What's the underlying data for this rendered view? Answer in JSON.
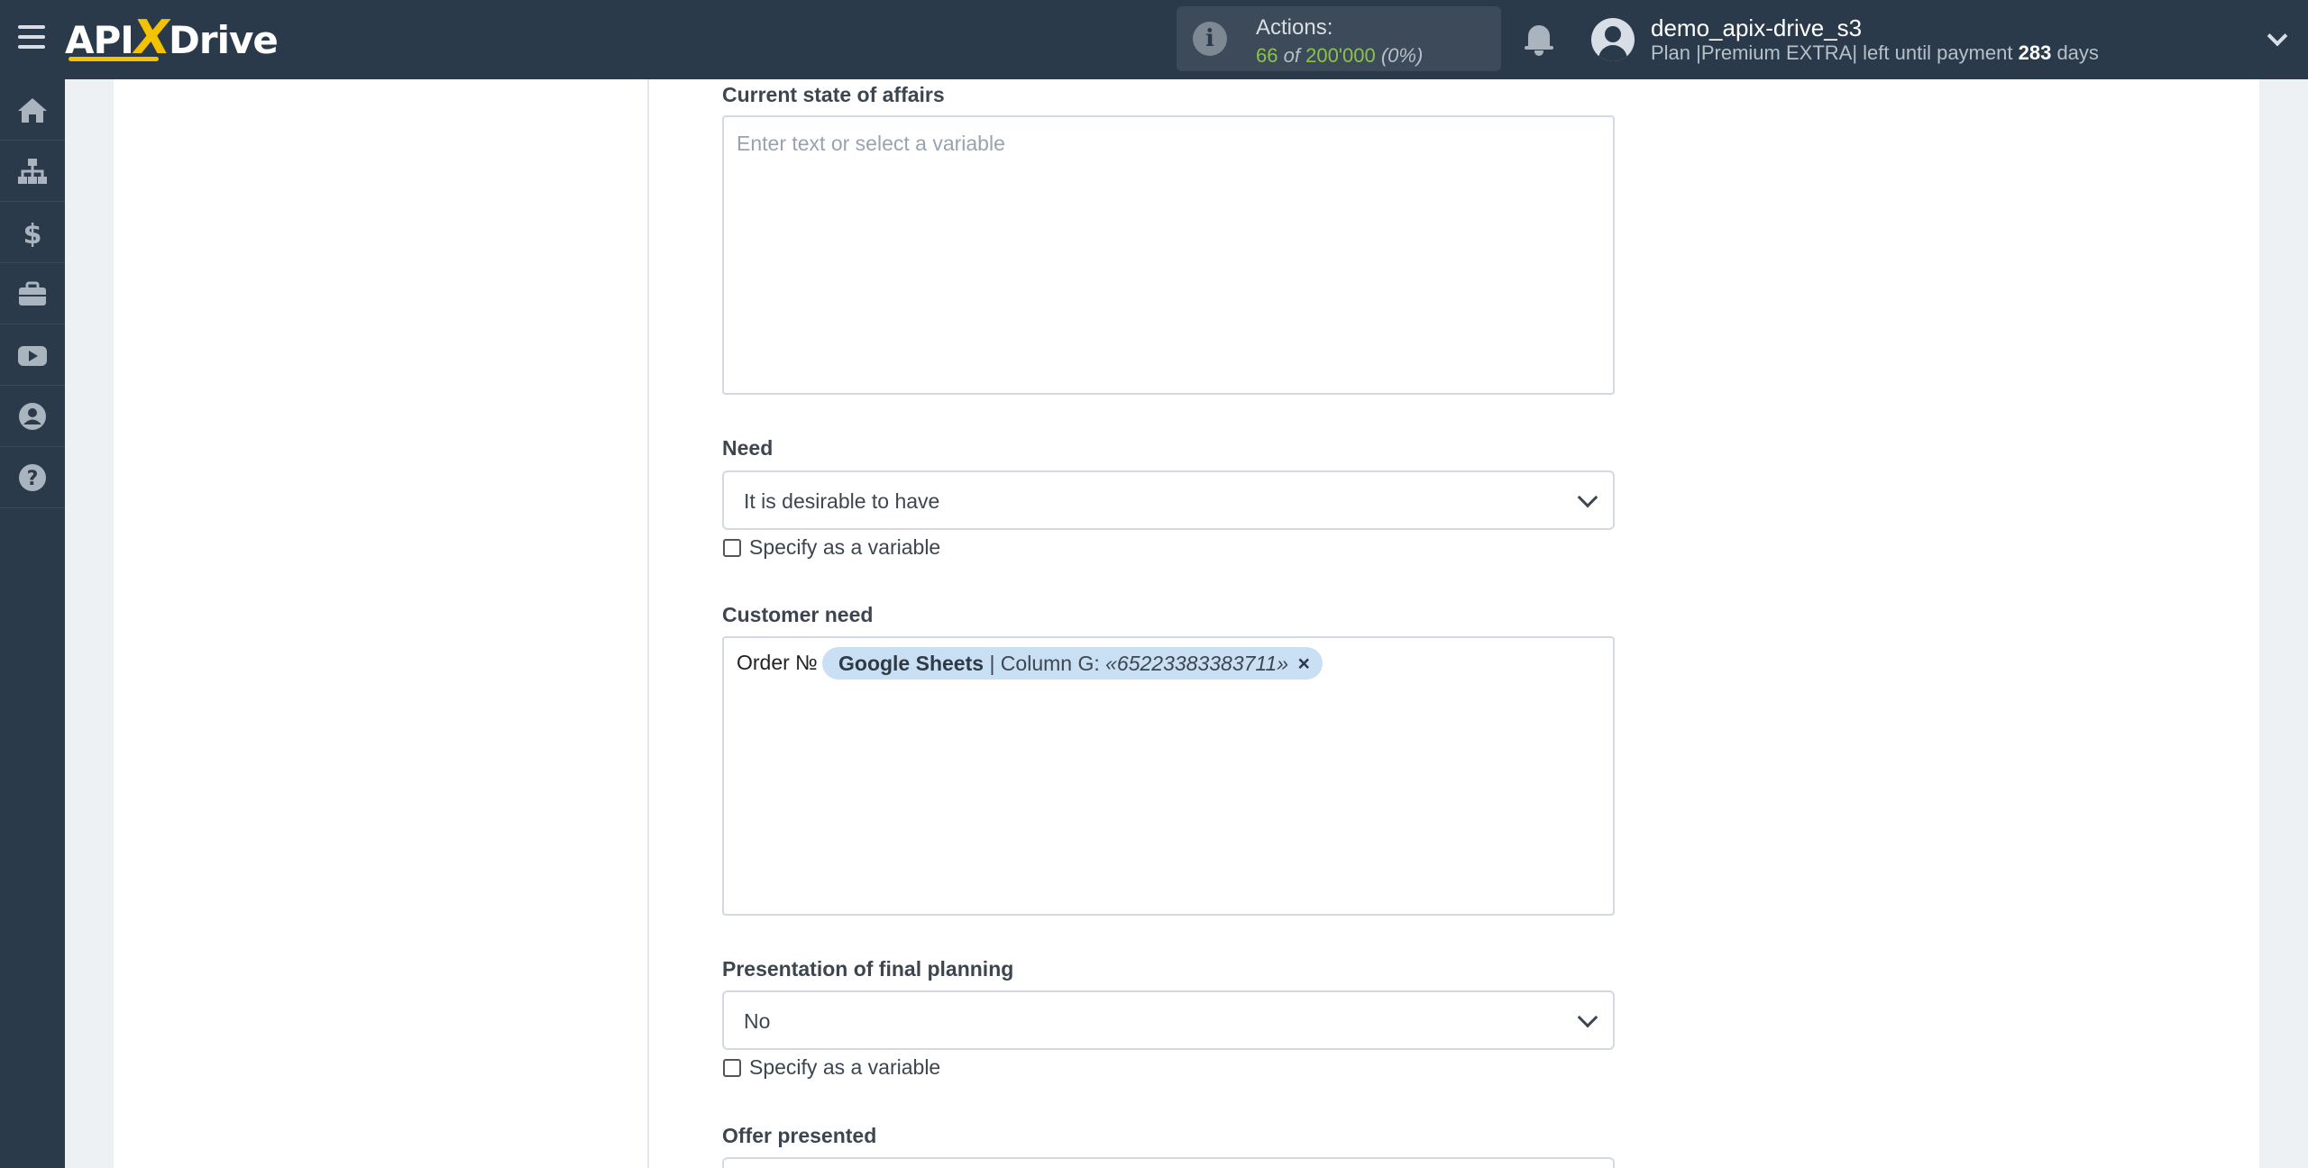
{
  "header": {
    "logo_left": "API",
    "logo_x": "X",
    "logo_right": "Drive",
    "actions_label": "Actions:",
    "actions_used": "66",
    "actions_of": "of",
    "actions_total": "200'000",
    "actions_pct": "(0%)",
    "username": "demo_apix-drive_s3",
    "plan_prefix": "Plan |Premium EXTRA| left until payment",
    "plan_days": "283",
    "plan_suffix": "days"
  },
  "sidebar": {
    "items": [
      {
        "icon": "home-icon"
      },
      {
        "icon": "sitemap-icon"
      },
      {
        "icon": "dollar-icon"
      },
      {
        "icon": "briefcase-icon"
      },
      {
        "icon": "youtube-icon"
      },
      {
        "icon": "user-circle-icon"
      },
      {
        "icon": "help-icon"
      }
    ]
  },
  "form": {
    "current_state": {
      "label": "Current state of affairs",
      "placeholder": "Enter text or select a variable"
    },
    "need": {
      "label": "Need",
      "value": "It is desirable to have",
      "checkbox": "Specify as a variable"
    },
    "customer_need": {
      "label": "Customer need",
      "prefix": "Order №",
      "chip_source": "Google Sheets",
      "chip_column": "| Column G:",
      "chip_value": "«65223383383711»",
      "chip_remove": "×"
    },
    "presentation": {
      "label": "Presentation of final planning",
      "value": "No",
      "checkbox": "Specify as a variable"
    },
    "offer": {
      "label": "Offer presented"
    }
  },
  "colors": {
    "topbar": "#2b3a4a",
    "accent": "#f3c200",
    "actions_green": "#8bc34a",
    "chip_bg": "#c9dff4"
  }
}
